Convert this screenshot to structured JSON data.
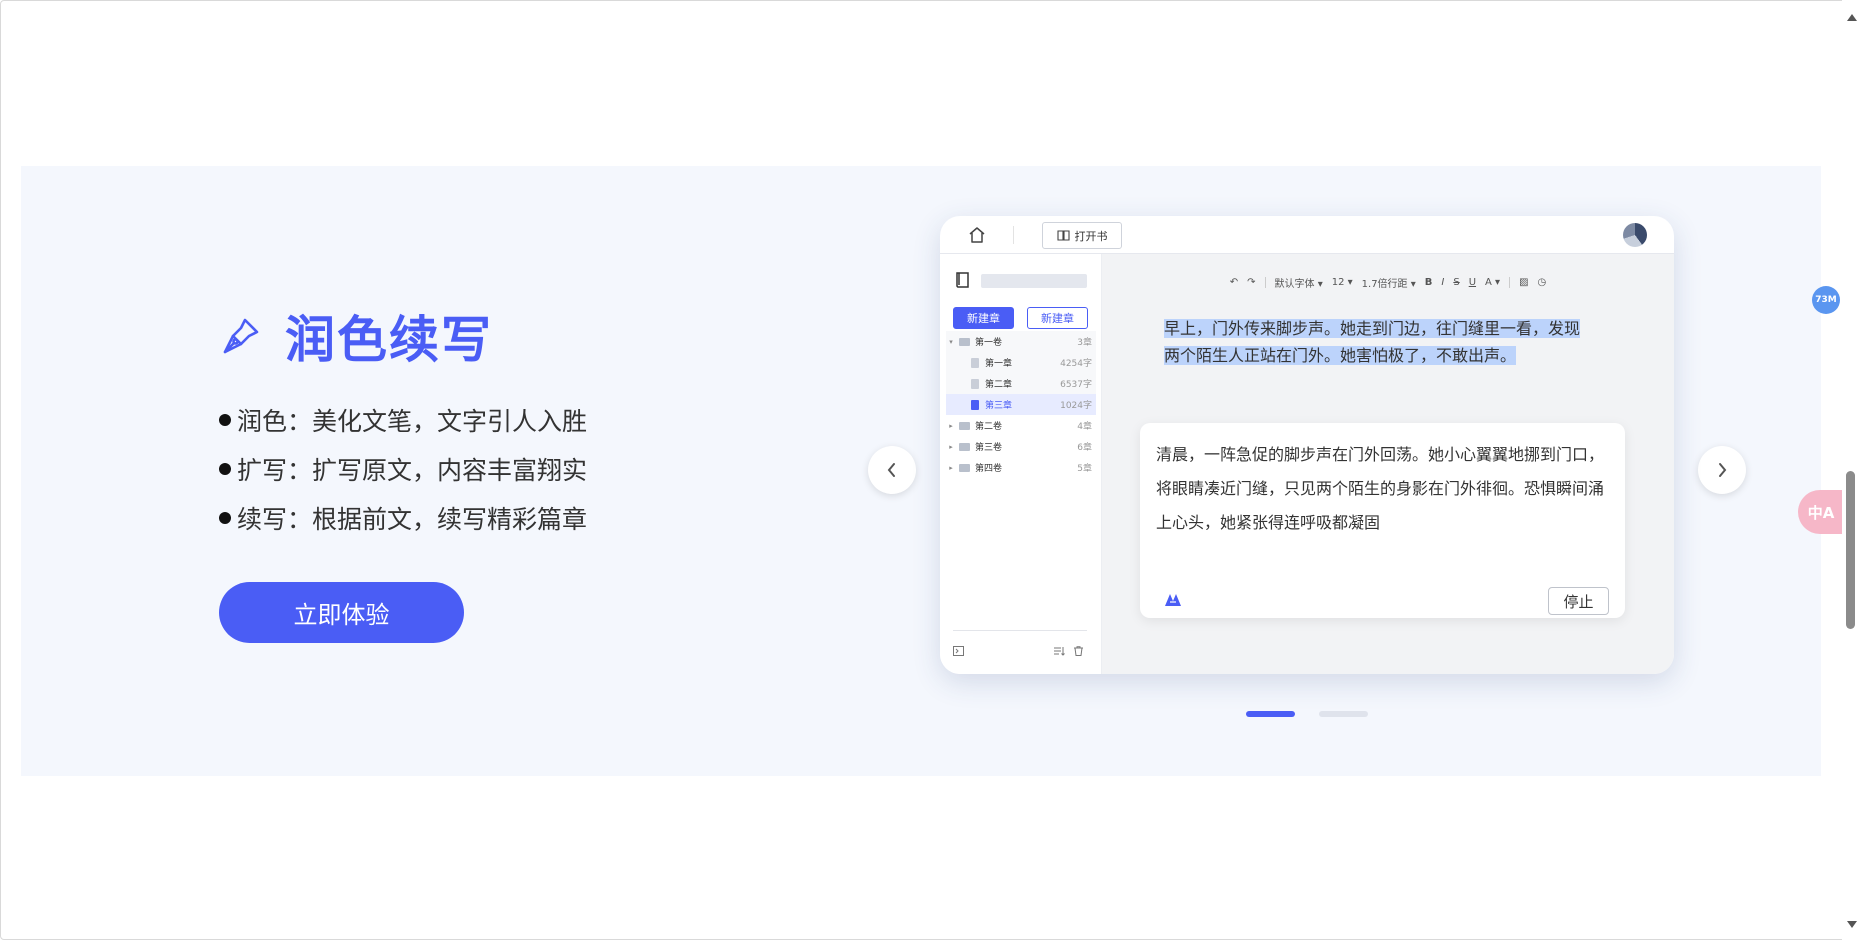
{
  "feature": {
    "title": "润色续写",
    "bullets": [
      "润色：美化文笔，文字引人入胜",
      "扩写：扩写原文，内容丰富翔实",
      "续写：根据前文，续写精彩篇章"
    ],
    "cta_label": "立即体验",
    "accent_color": "#4a5df5"
  },
  "mock": {
    "top": {
      "open_book_label": "打开书"
    },
    "sidebar": {
      "new_chapter_primary": "新建章",
      "new_chapter_outline": "新建章",
      "volumes": [
        {
          "name": "第一卷",
          "count": "3章",
          "chapters": [
            {
              "name": "第一章",
              "words": "4254字"
            },
            {
              "name": "第二章",
              "words": "6537字"
            },
            {
              "name": "第三章",
              "words": "1024字"
            }
          ]
        },
        {
          "name": "第二卷",
          "count": "4章"
        },
        {
          "name": "第三卷",
          "count": "6章"
        },
        {
          "name": "第四卷",
          "count": "5章"
        }
      ]
    },
    "toolbar": {
      "font": "默认字体",
      "size": "12",
      "line_spacing": "1.7倍行距",
      "bold": "B",
      "italic": "I",
      "strike": "S",
      "underline": "U",
      "color": "A"
    },
    "selected_text": "早上，门外传来脚步声。她走到门边，往门缝里一看，发现两个陌生人正站在门外。她害怕极了，不敢出声。",
    "ai_output": "清晨，一阵急促的脚步声在门外回荡。她小心翼翼地挪到门口，将眼睛凑近门缝，只见两个陌生的身影在门外徘徊。恐惧瞬间涌上心头，她紧张得连呼吸都凝固",
    "stop_label": "停止"
  },
  "floaters": {
    "memory_badge": "73M",
    "translate_label": "中A"
  }
}
